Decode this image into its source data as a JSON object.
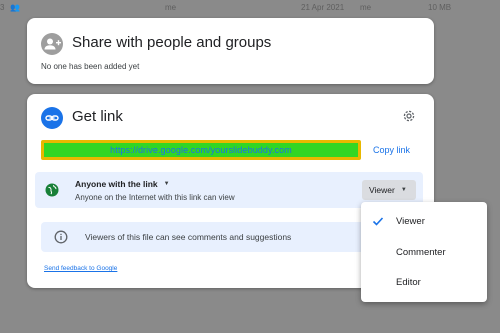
{
  "background_row": {
    "count": "3",
    "owner": "me",
    "date": "21 Apr 2021",
    "owner2": "me",
    "size": "10 MB"
  },
  "share": {
    "title": "Share with people and groups",
    "subtitle": "No one has been added yet",
    "icon": "person-add-icon"
  },
  "get_link": {
    "title": "Get link",
    "icon": "link-icon",
    "settings_icon": "gear-icon",
    "url": "https://drive.google.com/yourslidebuddy.com",
    "copy_label": "Copy link",
    "access": {
      "title": "Anyone with the link",
      "subtitle": "Anyone on the Internet with this link can view",
      "role": "Viewer"
    },
    "info": "Viewers of this file can see comments and suggestions",
    "feedback": "Send feedback to Google"
  },
  "role_menu": {
    "items": [
      {
        "label": "Viewer",
        "selected": true
      },
      {
        "label": "Commenter",
        "selected": false
      },
      {
        "label": "Editor",
        "selected": false
      }
    ]
  },
  "colors": {
    "accent": "#1a73e8",
    "highlight_fill": "#32d624",
    "highlight_border": "#e8b800"
  }
}
